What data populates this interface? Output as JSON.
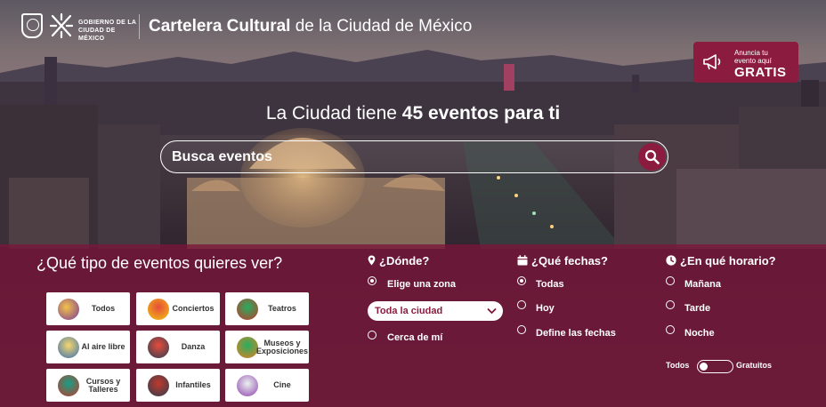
{
  "header": {
    "gov_line1": "Gobierno de la",
    "gov_line2": "Ciudad de México",
    "title_bold": "Cartelera Cultural",
    "title_rest": " de la Ciudad de México"
  },
  "announce": {
    "line1": "Anuncia tu",
    "line2": "evento aquí",
    "big": "GRATIS",
    "icon": "megaphone-icon"
  },
  "hero": {
    "prefix": "La Ciudad tiene ",
    "highlight": "45 eventos para ti"
  },
  "search": {
    "placeholder": "Busca eventos",
    "button_icon": "search-icon"
  },
  "event_types": {
    "title": "¿Qué tipo de eventos quieres ver?",
    "items": [
      {
        "label": "Todos",
        "icon": "todos-icon"
      },
      {
        "label": "Conciertos",
        "icon": "conciertos-icon"
      },
      {
        "label": "Teatros",
        "icon": "teatros-icon"
      },
      {
        "label": "Al aire libre",
        "icon": "aire-libre-icon"
      },
      {
        "label": "Danza",
        "icon": "danza-icon"
      },
      {
        "label": "Museos y Exposiciones",
        "icon": "museos-icon"
      },
      {
        "label": "Cursos y Talleres",
        "icon": "cursos-icon"
      },
      {
        "label": "Infantiles",
        "icon": "infantiles-icon"
      },
      {
        "label": "Cine",
        "icon": "cine-icon"
      }
    ]
  },
  "where": {
    "title": "¿Dónde?",
    "icon": "location-pin-icon",
    "options": [
      {
        "label": "Elige una zona",
        "selected": true
      },
      {
        "label": "Cerca de mí",
        "selected": false
      }
    ],
    "zone_value": "Toda la ciudad"
  },
  "when": {
    "title": "¿Qué fechas?",
    "icon": "calendar-icon",
    "options": [
      {
        "label": "Todas",
        "selected": true
      },
      {
        "label": "Hoy",
        "selected": false
      },
      {
        "label": "Define las fechas",
        "selected": false
      }
    ]
  },
  "schedule": {
    "title": "¿En qué horario?",
    "icon": "clock-icon",
    "options": [
      {
        "label": "Mañana",
        "selected": false
      },
      {
        "label": "Tarde",
        "selected": false
      },
      {
        "label": "Noche",
        "selected": false
      }
    ],
    "toggle_left": "Todos",
    "toggle_right": "Gratuitos",
    "toggle_on": false
  },
  "colors": {
    "brand": "#8c1c3f",
    "panel": "#7a163a"
  }
}
